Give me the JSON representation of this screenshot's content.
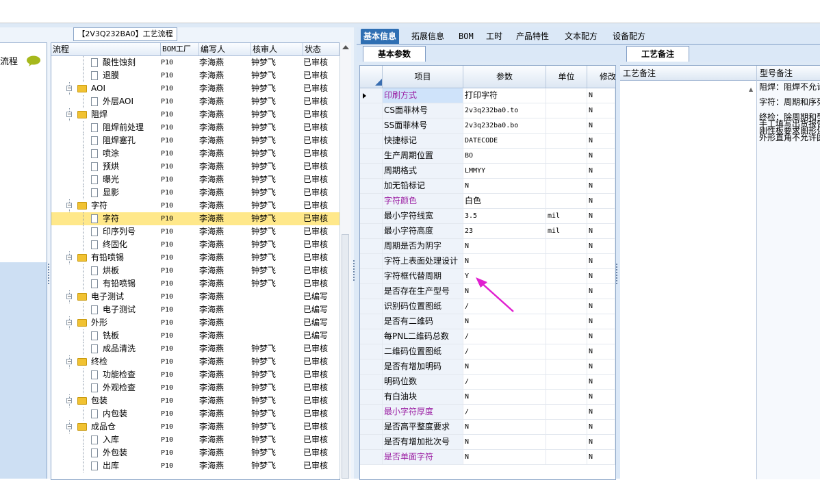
{
  "left": {
    "side_label": "流程",
    "title_tab": "【2V3Q232BA0】工艺流程",
    "columns": [
      "流程",
      "BOM工厂",
      "编写人",
      "核审人",
      "状态"
    ],
    "rows": [
      {
        "level": 1,
        "type": "doc",
        "label": "酸性蚀刻",
        "bom": "P10",
        "author": "李海燕",
        "checker": "钟梦飞",
        "status": "已审核"
      },
      {
        "level": 1,
        "type": "doc",
        "label": "退膜",
        "bom": "P10",
        "author": "李海燕",
        "checker": "钟梦飞",
        "status": "已审核"
      },
      {
        "level": 0,
        "type": "folder",
        "label": "AOI",
        "bom": "P10",
        "author": "李海燕",
        "checker": "钟梦飞",
        "status": "已审核"
      },
      {
        "level": 1,
        "type": "doc",
        "label": "外层AOI",
        "bom": "P10",
        "author": "李海燕",
        "checker": "钟梦飞",
        "status": "已审核"
      },
      {
        "level": 0,
        "type": "folder",
        "label": "阻焊",
        "bom": "P10",
        "author": "李海燕",
        "checker": "钟梦飞",
        "status": "已审核"
      },
      {
        "level": 1,
        "type": "doc",
        "label": "阻焊前处理",
        "bom": "P10",
        "author": "李海燕",
        "checker": "钟梦飞",
        "status": "已审核"
      },
      {
        "level": 1,
        "type": "doc",
        "label": "阻焊塞孔",
        "bom": "P10",
        "author": "李海燕",
        "checker": "钟梦飞",
        "status": "已审核"
      },
      {
        "level": 1,
        "type": "doc",
        "label": "喷涂",
        "bom": "P10",
        "author": "李海燕",
        "checker": "钟梦飞",
        "status": "已审核"
      },
      {
        "level": 1,
        "type": "doc",
        "label": "预烘",
        "bom": "P10",
        "author": "李海燕",
        "checker": "钟梦飞",
        "status": "已审核"
      },
      {
        "level": 1,
        "type": "doc",
        "label": "曝光",
        "bom": "P10",
        "author": "李海燕",
        "checker": "钟梦飞",
        "status": "已审核"
      },
      {
        "level": 1,
        "type": "doc",
        "label": "显影",
        "bom": "P10",
        "author": "李海燕",
        "checker": "钟梦飞",
        "status": "已审核"
      },
      {
        "level": 0,
        "type": "folder",
        "label": "字符",
        "bom": "P10",
        "author": "李海燕",
        "checker": "钟梦飞",
        "status": "已审核"
      },
      {
        "level": 1,
        "type": "doc",
        "label": "字符",
        "bom": "P10",
        "author": "李海燕",
        "checker": "钟梦飞",
        "status": "已审核",
        "selected": true
      },
      {
        "level": 1,
        "type": "doc",
        "label": "印序列号",
        "bom": "P10",
        "author": "李海燕",
        "checker": "钟梦飞",
        "status": "已审核"
      },
      {
        "level": 1,
        "type": "doc",
        "label": "终固化",
        "bom": "P10",
        "author": "李海燕",
        "checker": "钟梦飞",
        "status": "已审核"
      },
      {
        "level": 0,
        "type": "folder",
        "label": "有铅喷锡",
        "bom": "P10",
        "author": "李海燕",
        "checker": "钟梦飞",
        "status": "已审核"
      },
      {
        "level": 1,
        "type": "doc",
        "label": "烘板",
        "bom": "P10",
        "author": "李海燕",
        "checker": "钟梦飞",
        "status": "已审核"
      },
      {
        "level": 1,
        "type": "doc",
        "label": "有铅喷锡",
        "bom": "P10",
        "author": "李海燕",
        "checker": "钟梦飞",
        "status": "已审核"
      },
      {
        "level": 0,
        "type": "folder",
        "label": "电子测试",
        "bom": "P10",
        "author": "李海燕",
        "checker": "",
        "status": "已编写"
      },
      {
        "level": 1,
        "type": "doc",
        "label": "电子测试",
        "bom": "P10",
        "author": "李海燕",
        "checker": "",
        "status": "已编写"
      },
      {
        "level": 0,
        "type": "folder",
        "label": "外形",
        "bom": "P10",
        "author": "李海燕",
        "checker": "",
        "status": "已编写"
      },
      {
        "level": 1,
        "type": "doc",
        "label": "铣板",
        "bom": "P10",
        "author": "李海燕",
        "checker": "",
        "status": "已编写"
      },
      {
        "level": 1,
        "type": "doc",
        "label": "成品清洗",
        "bom": "P10",
        "author": "李海燕",
        "checker": "钟梦飞",
        "status": "已审核"
      },
      {
        "level": 0,
        "type": "folder",
        "label": "终检",
        "bom": "P10",
        "author": "李海燕",
        "checker": "钟梦飞",
        "status": "已审核"
      },
      {
        "level": 1,
        "type": "doc",
        "label": "功能检查",
        "bom": "P10",
        "author": "李海燕",
        "checker": "钟梦飞",
        "status": "已审核"
      },
      {
        "level": 1,
        "type": "doc",
        "label": "外观检查",
        "bom": "P10",
        "author": "李海燕",
        "checker": "钟梦飞",
        "status": "已审核"
      },
      {
        "level": 0,
        "type": "folder",
        "label": "包装",
        "bom": "P10",
        "author": "李海燕",
        "checker": "钟梦飞",
        "status": "已审核"
      },
      {
        "level": 1,
        "type": "doc",
        "label": "内包装",
        "bom": "P10",
        "author": "李海燕",
        "checker": "钟梦飞",
        "status": "已审核"
      },
      {
        "level": 0,
        "type": "folder",
        "label": "成品仓",
        "bom": "P10",
        "author": "李海燕",
        "checker": "钟梦飞",
        "status": "已审核"
      },
      {
        "level": 1,
        "type": "doc",
        "label": "入库",
        "bom": "P10",
        "author": "李海燕",
        "checker": "钟梦飞",
        "status": "已审核"
      },
      {
        "level": 1,
        "type": "doc",
        "label": "外包装",
        "bom": "P10",
        "author": "李海燕",
        "checker": "钟梦飞",
        "status": "已审核"
      },
      {
        "level": 1,
        "type": "doc",
        "label": "出库",
        "bom": "P10",
        "author": "李海燕",
        "checker": "钟梦飞",
        "status": "已审核"
      }
    ]
  },
  "tabs": [
    "基本信息",
    "拓展信息",
    "BOM",
    "工时",
    "产品特性",
    "文本配方",
    "设备配方"
  ],
  "active_tab": 0,
  "subtab": "基本参数",
  "grid": {
    "columns": [
      "项目",
      "参数",
      "单位",
      "修改"
    ],
    "rows": [
      {
        "name": "印刷方式",
        "param": "打印字符",
        "unit": "",
        "mod": "N",
        "purple": true,
        "current": true
      },
      {
        "name": "CS面菲林号",
        "param": "2v3q232ba0.to",
        "unit": "",
        "mod": "N"
      },
      {
        "name": "SS面菲林号",
        "param": "2v3q232ba0.bo",
        "unit": "",
        "mod": "N"
      },
      {
        "name": "快捷标记",
        "param": "DATECODE",
        "unit": "",
        "mod": "N"
      },
      {
        "name": "生产周期位置",
        "param": "BO",
        "unit": "",
        "mod": "N"
      },
      {
        "name": "周期格式",
        "param": "LMMYY",
        "unit": "",
        "mod": "N"
      },
      {
        "name": "加无铅标记",
        "param": "N",
        "unit": "",
        "mod": "N"
      },
      {
        "name": "字符颜色",
        "param": "白色",
        "unit": "",
        "mod": "N",
        "purple": true
      },
      {
        "name": "最小字符线宽",
        "param": "3.5",
        "unit": "mil",
        "mod": "N"
      },
      {
        "name": "最小字符高度",
        "param": "23",
        "unit": "mil",
        "mod": "N"
      },
      {
        "name": "周期是否为阴字",
        "param": "N",
        "unit": "",
        "mod": "N"
      },
      {
        "name": "字符上表面处理设计",
        "param": "N",
        "unit": "",
        "mod": "N"
      },
      {
        "name": "字符框代替周期",
        "param": "Y",
        "unit": "",
        "mod": "N"
      },
      {
        "name": "是否存在生产型号",
        "param": "N",
        "unit": "",
        "mod": "N"
      },
      {
        "name": "识别码位置图纸",
        "param": "/",
        "unit": "",
        "mod": "N"
      },
      {
        "name": "是否有二维码",
        "param": "N",
        "unit": "",
        "mod": "N"
      },
      {
        "name": "每PNL二维码总数",
        "param": "/",
        "unit": "",
        "mod": "N"
      },
      {
        "name": "二维码位置图纸",
        "param": "/",
        "unit": "",
        "mod": "N"
      },
      {
        "name": "是否有增加明码",
        "param": "N",
        "unit": "",
        "mod": "N"
      },
      {
        "name": "明码位数",
        "param": "/",
        "unit": "",
        "mod": "N"
      },
      {
        "name": "有白油块",
        "param": "N",
        "unit": "",
        "mod": "N"
      },
      {
        "name": "最小字符厚度",
        "param": "/",
        "unit": "",
        "mod": "N",
        "purple": true
      },
      {
        "name": "是否高平整度要求",
        "param": "N",
        "unit": "",
        "mod": "N"
      },
      {
        "name": "是否有增加批次号",
        "param": "N",
        "unit": "",
        "mod": "N"
      },
      {
        "name": "是否单面字符",
        "param": "N",
        "unit": "",
        "mod": "N",
        "purple": true
      }
    ]
  },
  "notes": {
    "tab": "工艺备注",
    "col1": "工艺备注",
    "col2": "型号备注",
    "lines": [
      "阻焊：阻焊不允许",
      "",
      "字符：周期和序列号",
      "",
      "终检：除周期和型号",
      "手工填写出货报告",
      "刚性板要求图形化",
      "外形直角不允许圆"
    ]
  },
  "colors": {
    "accent": "#2f6fb3",
    "purple": "#9b1fa3",
    "selected_row": "#ffe88a",
    "annotation_arrow": "#e01fd0"
  }
}
